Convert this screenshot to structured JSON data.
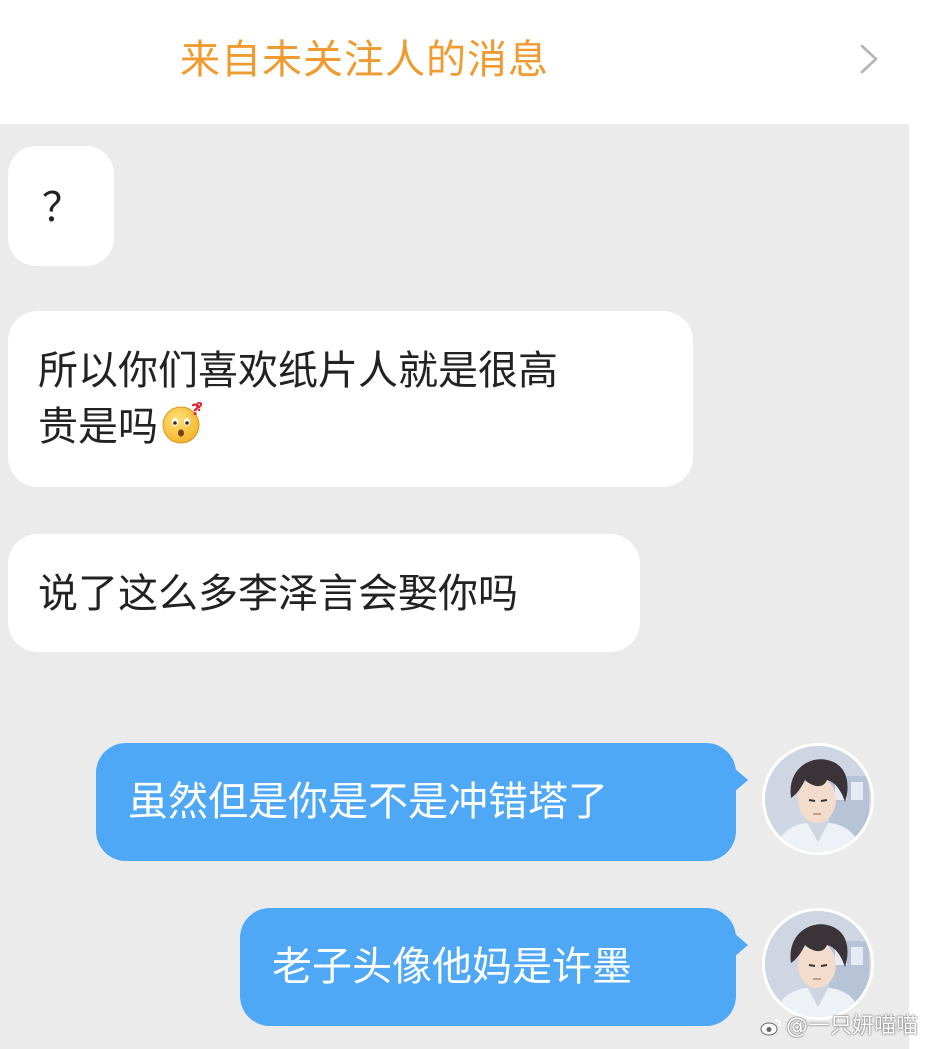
{
  "header": {
    "title": "来自未关注人的消息",
    "title_color": "#f19a2f",
    "chevron_icon": "chevron-right-icon"
  },
  "messages": [
    {
      "direction": "incoming",
      "text": "？"
    },
    {
      "direction": "incoming",
      "lines": [
        "所以你们喜欢纸片人就是很高",
        "贵是吗"
      ],
      "emoji": "confused-face-emoji"
    },
    {
      "direction": "incoming",
      "text": "说了这么多李泽言会娶你吗"
    },
    {
      "direction": "outgoing",
      "text": "虽然但是你是不是冲错塔了",
      "avatar": "anime-character-avatar"
    },
    {
      "direction": "outgoing",
      "text": "老子头像他妈是许墨",
      "avatar": "anime-character-avatar"
    }
  ],
  "colors": {
    "incoming_bubble": "#ffffff",
    "outgoing_bubble": "#4ea8f5",
    "chat_background": "#ebebeb"
  },
  "watermark": {
    "text": "@一只妍喵喵",
    "icon": "weibo-logo-icon"
  }
}
